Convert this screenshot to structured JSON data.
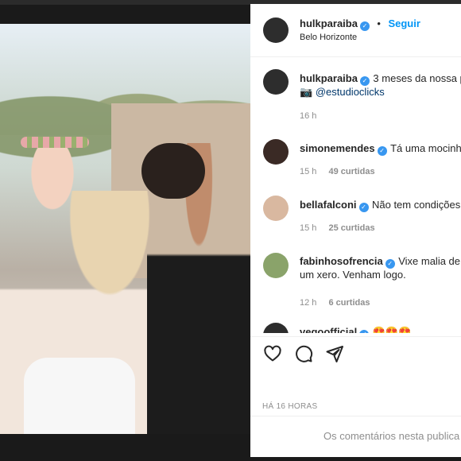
{
  "post_header": {
    "username": "hulkparaiba",
    "separator": "•",
    "follow_label": "Seguir",
    "location": "Belo Horizonte"
  },
  "caption": {
    "username": "hulkparaiba",
    "text": "3 meses da nossa p",
    "line2_emoji": "📷",
    "mention": "@estudioclicks",
    "time": "16 h"
  },
  "comments": [
    {
      "username": "simonemendes",
      "text": "Tá uma mocinh",
      "time": "15 h",
      "likes": "49 curtidas"
    },
    {
      "username": "bellafalconi",
      "text": "Não tem condições",
      "time": "15 h",
      "likes": "25 curtidas"
    },
    {
      "username": "fabinhosofrencia",
      "text": "Vixe malia de",
      "text2": "um xero. Venham logo.",
      "time": "12 h",
      "likes": "6 curtidas"
    },
    {
      "username": "vegoofficial",
      "text": "😍😍😍"
    }
  ],
  "post_time": "HÁ 16 HORAS",
  "comment_placeholder": "Os comentários nesta publica",
  "carousel": {
    "total": 9,
    "active_index": 6
  },
  "colors": {
    "accent": "#0095f6",
    "verified": "#3897f0",
    "muted": "#8e8e8e"
  }
}
